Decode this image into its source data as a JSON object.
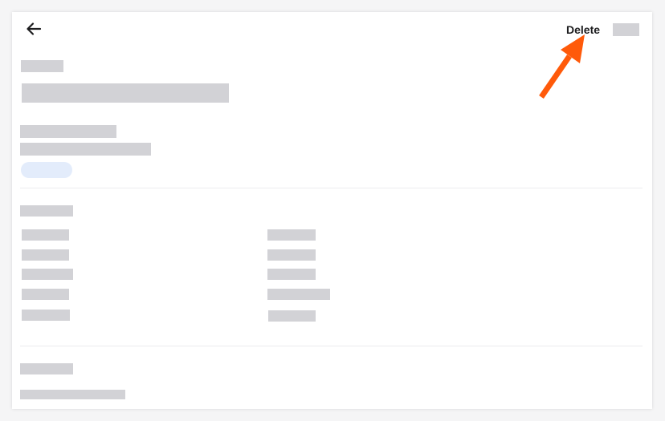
{
  "header": {
    "back_icon": "arrow-left-icon",
    "delete_label": "Delete"
  },
  "annotation": {
    "pointer_icon": "arrow-pointer-icon",
    "color": "#ff5a0a"
  },
  "colors": {
    "placeholder": "#d2d2d6",
    "badge": "#e3ecfb",
    "divider": "#ececee"
  }
}
